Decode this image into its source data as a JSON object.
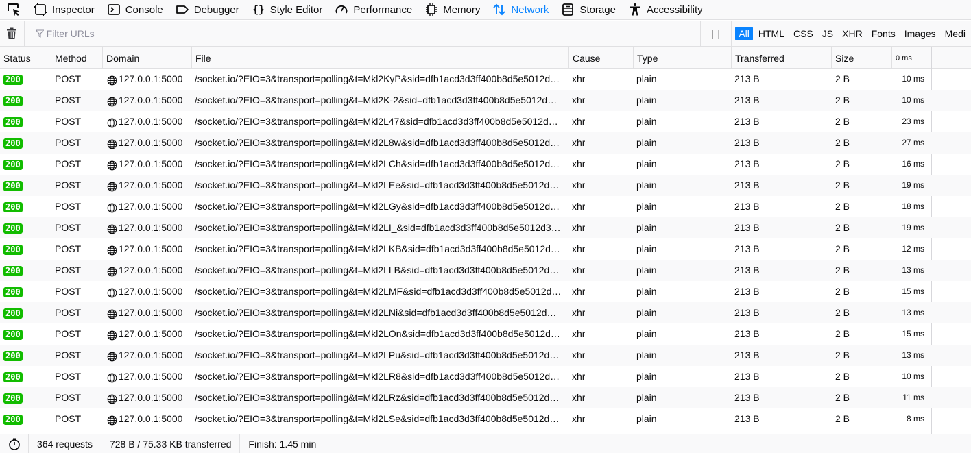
{
  "tabs": [
    {
      "label": "Inspector",
      "icon": "inspector-icon"
    },
    {
      "label": "Console",
      "icon": "console-icon"
    },
    {
      "label": "Debugger",
      "icon": "debugger-icon"
    },
    {
      "label": "Style Editor",
      "icon": "style-editor-icon"
    },
    {
      "label": "Performance",
      "icon": "performance-icon"
    },
    {
      "label": "Memory",
      "icon": "memory-icon"
    },
    {
      "label": "Network",
      "icon": "network-icon",
      "selected": true
    },
    {
      "label": "Storage",
      "icon": "storage-icon"
    },
    {
      "label": "Accessibility",
      "icon": "accessibility-icon"
    }
  ],
  "toolbar": {
    "filter_placeholder": "Filter URLs",
    "pause_label": "| |",
    "chips": [
      {
        "label": "All",
        "active": true
      },
      {
        "label": "HTML"
      },
      {
        "label": "CSS"
      },
      {
        "label": "JS"
      },
      {
        "label": "XHR"
      },
      {
        "label": "Fonts"
      },
      {
        "label": "Images"
      },
      {
        "label": "Medi"
      }
    ]
  },
  "columns": {
    "status": "Status",
    "method": "Method",
    "domain": "Domain",
    "file": "File",
    "cause": "Cause",
    "type": "Type",
    "transferred": "Transferred",
    "size": "Size",
    "waterfall": "0 ms"
  },
  "requests": [
    {
      "status": "200",
      "method": "POST",
      "domain": "127.0.0.1:5000",
      "file": "/socket.io/?EIO=3&transport=polling&t=Mkl2KyP&sid=dfb1acd3d3ff400b8d5e5012d…",
      "cause": "xhr",
      "type": "plain",
      "transferred": "213 B",
      "size": "2 B",
      "time": "10 ms"
    },
    {
      "status": "200",
      "method": "POST",
      "domain": "127.0.0.1:5000",
      "file": "/socket.io/?EIO=3&transport=polling&t=Mkl2K-2&sid=dfb1acd3d3ff400b8d5e5012d…",
      "cause": "xhr",
      "type": "plain",
      "transferred": "213 B",
      "size": "2 B",
      "time": "10 ms"
    },
    {
      "status": "200",
      "method": "POST",
      "domain": "127.0.0.1:5000",
      "file": "/socket.io/?EIO=3&transport=polling&t=Mkl2L47&sid=dfb1acd3d3ff400b8d5e5012d…",
      "cause": "xhr",
      "type": "plain",
      "transferred": "213 B",
      "size": "2 B",
      "time": "23 ms"
    },
    {
      "status": "200",
      "method": "POST",
      "domain": "127.0.0.1:5000",
      "file": "/socket.io/?EIO=3&transport=polling&t=Mkl2L8w&sid=dfb1acd3d3ff400b8d5e5012d…",
      "cause": "xhr",
      "type": "plain",
      "transferred": "213 B",
      "size": "2 B",
      "time": "27 ms"
    },
    {
      "status": "200",
      "method": "POST",
      "domain": "127.0.0.1:5000",
      "file": "/socket.io/?EIO=3&transport=polling&t=Mkl2LCh&sid=dfb1acd3d3ff400b8d5e5012d…",
      "cause": "xhr",
      "type": "plain",
      "transferred": "213 B",
      "size": "2 B",
      "time": "16 ms"
    },
    {
      "status": "200",
      "method": "POST",
      "domain": "127.0.0.1:5000",
      "file": "/socket.io/?EIO=3&transport=polling&t=Mkl2LEe&sid=dfb1acd3d3ff400b8d5e5012d…",
      "cause": "xhr",
      "type": "plain",
      "transferred": "213 B",
      "size": "2 B",
      "time": "19 ms"
    },
    {
      "status": "200",
      "method": "POST",
      "domain": "127.0.0.1:5000",
      "file": "/socket.io/?EIO=3&transport=polling&t=Mkl2LGy&sid=dfb1acd3d3ff400b8d5e5012d…",
      "cause": "xhr",
      "type": "plain",
      "transferred": "213 B",
      "size": "2 B",
      "time": "18 ms"
    },
    {
      "status": "200",
      "method": "POST",
      "domain": "127.0.0.1:5000",
      "file": "/socket.io/?EIO=3&transport=polling&t=Mkl2LI_&sid=dfb1acd3d3ff400b8d5e5012d3…",
      "cause": "xhr",
      "type": "plain",
      "transferred": "213 B",
      "size": "2 B",
      "time": "19 ms"
    },
    {
      "status": "200",
      "method": "POST",
      "domain": "127.0.0.1:5000",
      "file": "/socket.io/?EIO=3&transport=polling&t=Mkl2LKB&sid=dfb1acd3d3ff400b8d5e5012d…",
      "cause": "xhr",
      "type": "plain",
      "transferred": "213 B",
      "size": "2 B",
      "time": "12 ms"
    },
    {
      "status": "200",
      "method": "POST",
      "domain": "127.0.0.1:5000",
      "file": "/socket.io/?EIO=3&transport=polling&t=Mkl2LLB&sid=dfb1acd3d3ff400b8d5e5012d…",
      "cause": "xhr",
      "type": "plain",
      "transferred": "213 B",
      "size": "2 B",
      "time": "13 ms"
    },
    {
      "status": "200",
      "method": "POST",
      "domain": "127.0.0.1:5000",
      "file": "/socket.io/?EIO=3&transport=polling&t=Mkl2LMF&sid=dfb1acd3d3ff400b8d5e5012d…",
      "cause": "xhr",
      "type": "plain",
      "transferred": "213 B",
      "size": "2 B",
      "time": "15 ms"
    },
    {
      "status": "200",
      "method": "POST",
      "domain": "127.0.0.1:5000",
      "file": "/socket.io/?EIO=3&transport=polling&t=Mkl2LNi&sid=dfb1acd3d3ff400b8d5e5012d…",
      "cause": "xhr",
      "type": "plain",
      "transferred": "213 B",
      "size": "2 B",
      "time": "13 ms"
    },
    {
      "status": "200",
      "method": "POST",
      "domain": "127.0.0.1:5000",
      "file": "/socket.io/?EIO=3&transport=polling&t=Mkl2LOn&sid=dfb1acd3d3ff400b8d5e5012d…",
      "cause": "xhr",
      "type": "plain",
      "transferred": "213 B",
      "size": "2 B",
      "time": "15 ms"
    },
    {
      "status": "200",
      "method": "POST",
      "domain": "127.0.0.1:5000",
      "file": "/socket.io/?EIO=3&transport=polling&t=Mkl2LPu&sid=dfb1acd3d3ff400b8d5e5012d…",
      "cause": "xhr",
      "type": "plain",
      "transferred": "213 B",
      "size": "2 B",
      "time": "13 ms"
    },
    {
      "status": "200",
      "method": "POST",
      "domain": "127.0.0.1:5000",
      "file": "/socket.io/?EIO=3&transport=polling&t=Mkl2LR8&sid=dfb1acd3d3ff400b8d5e5012d…",
      "cause": "xhr",
      "type": "plain",
      "transferred": "213 B",
      "size": "2 B",
      "time": "10 ms"
    },
    {
      "status": "200",
      "method": "POST",
      "domain": "127.0.0.1:5000",
      "file": "/socket.io/?EIO=3&transport=polling&t=Mkl2LRz&sid=dfb1acd3d3ff400b8d5e5012d…",
      "cause": "xhr",
      "type": "plain",
      "transferred": "213 B",
      "size": "2 B",
      "time": "11 ms"
    },
    {
      "status": "200",
      "method": "POST",
      "domain": "127.0.0.1:5000",
      "file": "/socket.io/?EIO=3&transport=polling&t=Mkl2LSe&sid=dfb1acd3d3ff400b8d5e5012d…",
      "cause": "xhr",
      "type": "plain",
      "transferred": "213 B",
      "size": "2 B",
      "time": "8 ms"
    }
  ],
  "statusbar": {
    "requests": "364 requests",
    "transferred": "728 B / 75.33 KB transferred",
    "finish": "Finish: 1.45 min"
  },
  "colors": {
    "accent": "#0a84ff",
    "status_ok": "#12bc00"
  }
}
